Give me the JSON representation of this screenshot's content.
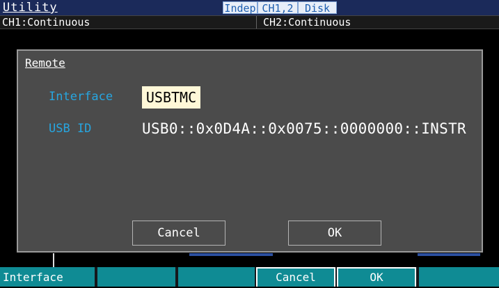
{
  "header": {
    "title": "Utility",
    "tabs": [
      "Indep",
      "CH1,2",
      "Disk"
    ]
  },
  "channels": {
    "ch1": "CH1:Continuous",
    "ch2": "CH2:Continuous"
  },
  "dialog": {
    "title": "Remote",
    "interface_label": "Interface",
    "interface_value": "USBTMC",
    "usbid_label": "USB ID",
    "usbid_value": "USB0::0x0D4A::0x0075::0000000::INSTR",
    "cancel_label": "Cancel",
    "ok_label": "OK"
  },
  "softkeys": [
    "Interface",
    "",
    "",
    "Cancel",
    "OK",
    ""
  ],
  "colors": {
    "label_blue": "#27a6e0",
    "softkey_teal": "#0f8b94",
    "dialog_gray": "#4b4b4b",
    "highlight": "#fff8d8"
  }
}
